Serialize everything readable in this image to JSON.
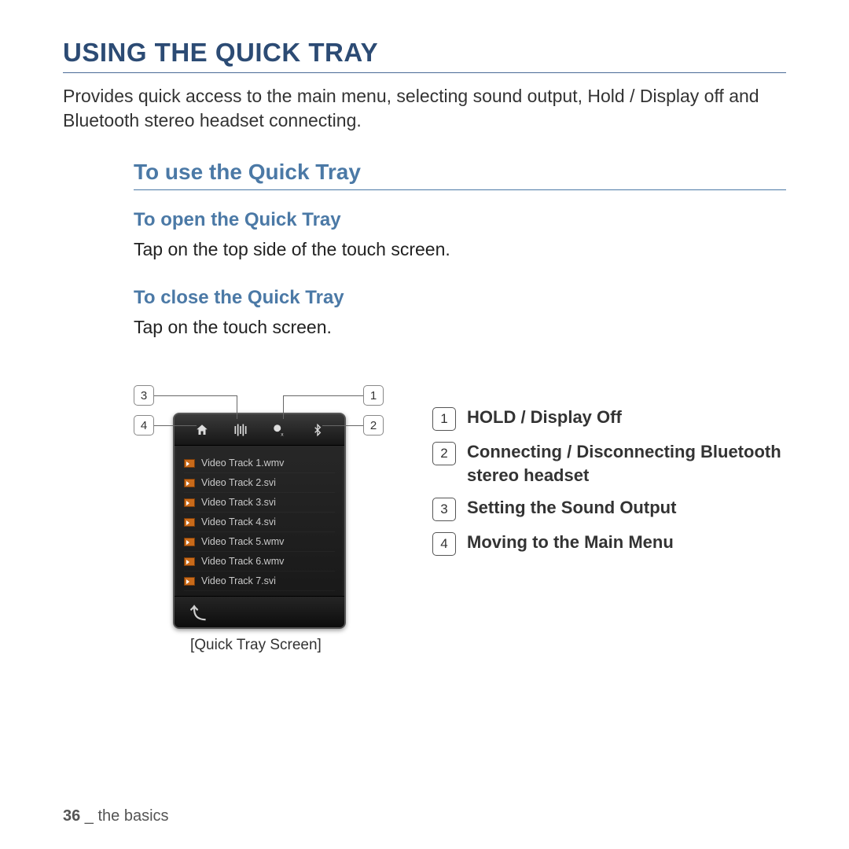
{
  "title": "USING THE QUICK TRAY",
  "intro": "Provides quick access to the main menu, selecting sound output, Hold / Display off and Bluetooth stereo headset connecting.",
  "section_title": "To use the Quick Tray",
  "open": {
    "heading": "To open the Quick Tray",
    "body": "Tap on the top side of the touch screen."
  },
  "close": {
    "heading": "To close the Quick Tray",
    "body": "Tap on the touch screen."
  },
  "callouts": {
    "c1": "1",
    "c2": "2",
    "c3": "3",
    "c4": "4"
  },
  "tray_icons": {
    "home": "home-icon",
    "sound": "sound-output-icon",
    "hold": "hold-display-off-icon",
    "bluetooth": "bluetooth-icon"
  },
  "tracks": [
    "Video Track 1.wmv",
    "Video Track 2.svi",
    "Video Track 3.svi",
    "Video Track 4.svi",
    "Video Track 5.wmv",
    "Video Track 6.wmv",
    "Video Track 7.svi"
  ],
  "back_glyph": "↩",
  "caption": "[Quick Tray Screen]",
  "legend": [
    {
      "n": "1",
      "text": "HOLD / Display Off"
    },
    {
      "n": "2",
      "text": "Connecting / Disconnecting Bluetooth stereo headset"
    },
    {
      "n": "3",
      "text": "Setting the Sound Output"
    },
    {
      "n": "4",
      "text": "Moving to the Main Menu"
    }
  ],
  "footer": {
    "page": "36",
    "sep": " _ ",
    "chapter": "the basics"
  }
}
